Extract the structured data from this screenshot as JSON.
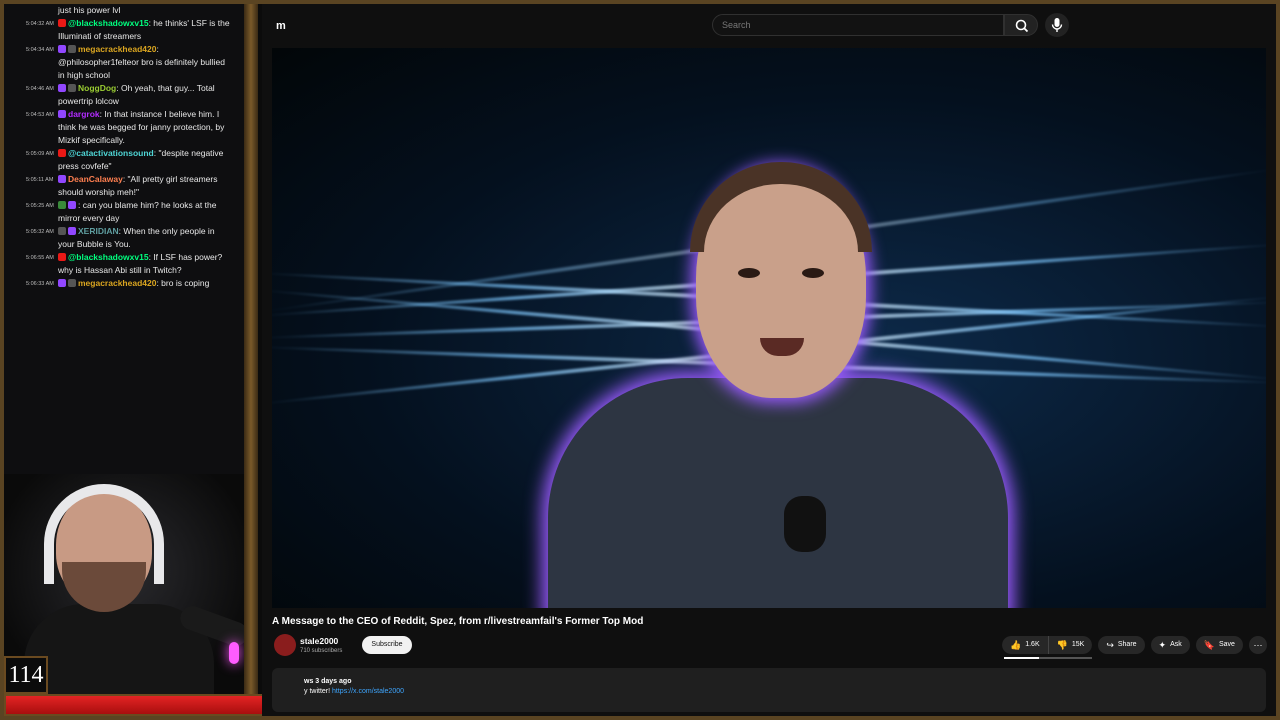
{
  "chat": {
    "messages": [
      {
        "time": "",
        "badges": [],
        "user": "",
        "user_color": "#ffffff",
        "text": "just his power lvl"
      },
      {
        "time": "5:04:32 AM",
        "badges": [
          "#e91916"
        ],
        "user": "@blackshadowxv15",
        "user_color": "#00ff7f",
        "text": ": he thinks' LSF is the Illuminati of streamers"
      },
      {
        "time": "5:04:34 AM",
        "badges": [
          "#9147ff",
          "#555555"
        ],
        "user": "megacrackhead420",
        "user_color": "#daa520",
        "text": ": @philosopher1felteor bro is definitely bullied in high school"
      },
      {
        "time": "5:04:46 AM",
        "badges": [
          "#9147ff",
          "#555555"
        ],
        "user": "NoggDog",
        "user_color": "#9acd32",
        "text": ": Oh yeah, that guy... Total powertrip lolcow"
      },
      {
        "time": "5:04:53 AM",
        "badges": [
          "#9147ff"
        ],
        "user": "dargrok",
        "user_color": "#b22cff",
        "text": ": In that instance I believe him. I think he was begged for janny protection, by Mizkif specifically."
      },
      {
        "time": "5:05:09 AM",
        "badges": [
          "#e91916"
        ],
        "user": "@catactivationsound",
        "user_color": "#4fd6d6",
        "text": ": \"despite negative press covfefe\""
      },
      {
        "time": "5:05:11 AM",
        "badges": [
          "#9147ff"
        ],
        "user": "DeanCalaway",
        "user_color": "#ff7f50",
        "text": ": \"All pretty girl streamers should worship meh!\""
      },
      {
        "time": "5:05:25 AM",
        "badges": [
          "#3a8a3a",
          "#9147ff"
        ],
        "user": "",
        "user_color": "#ffffff",
        "text": ": can you blame him? he looks at the mirror every day"
      },
      {
        "time": "5:05:32 AM",
        "badges": [
          "#555555",
          "#9147ff"
        ],
        "user": "XERIDIAN",
        "user_color": "#5f9ea0",
        "text": ": When the only people in your Bubble is You."
      },
      {
        "time": "5:06:55 AM",
        "badges": [
          "#e91916"
        ],
        "user": "@blackshadowxv15",
        "user_color": "#00ff7f",
        "text": ": If LSF has power? why is Hassan Abi still in Twitch?"
      },
      {
        "time": "5:06:33 AM",
        "badges": [
          "#9147ff",
          "#555555"
        ],
        "user": "megacrackhead420",
        "user_color": "#daa520",
        "text": ": bro is coping"
      }
    ]
  },
  "overlay": {
    "level": "114",
    "health_fraction": 1.0
  },
  "youtube": {
    "logo_fragment": "m",
    "search_placeholder": "Search",
    "icons": {
      "search": "search-icon",
      "mic": "microphone-icon"
    },
    "video_title": "A Message to the CEO of Reddit, Spez, from r/livestreamfail's Former Top Mod",
    "channel_name": "stale2000",
    "channel_subs": "710 subscribers",
    "subscribe_label": "Subscribe",
    "likes": "1.6K",
    "dislikes": "15K",
    "like_ratio": 0.4,
    "share_label": "Share",
    "ask_label": "Ask",
    "save_label": "Save",
    "desc_meta": "ws  3 days ago",
    "desc_link_label": "y twitter! ",
    "desc_link": "https://x.com/stale2000"
  },
  "colors": {
    "frame": "#5a4422",
    "health": "#e42424",
    "glow": "#9b5cff",
    "link": "#3ea6ff"
  }
}
